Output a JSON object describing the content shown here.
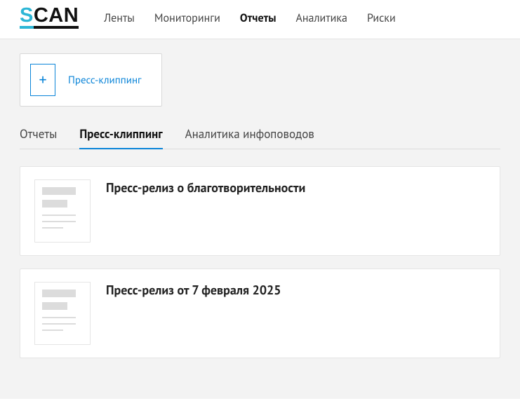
{
  "logo": {
    "s": "S",
    "can": "CAN"
  },
  "nav": {
    "items": [
      {
        "label": "Ленты",
        "active": false
      },
      {
        "label": "Мониторинги",
        "active": false
      },
      {
        "label": "Отчеты",
        "active": true
      },
      {
        "label": "Аналитика",
        "active": false
      },
      {
        "label": "Риски",
        "active": false
      }
    ]
  },
  "create": {
    "label": "Пресс-клиппинг",
    "plus": "+"
  },
  "tabs": {
    "items": [
      {
        "label": "Отчеты",
        "active": false
      },
      {
        "label": "Пресс-клиппинг",
        "active": true
      },
      {
        "label": "Аналитика инфоповодов",
        "active": false
      }
    ]
  },
  "cards": [
    {
      "title": "Пресс-релиз о благотворительности"
    },
    {
      "title": "Пресс-релиз от 7 февраля 2025"
    }
  ]
}
